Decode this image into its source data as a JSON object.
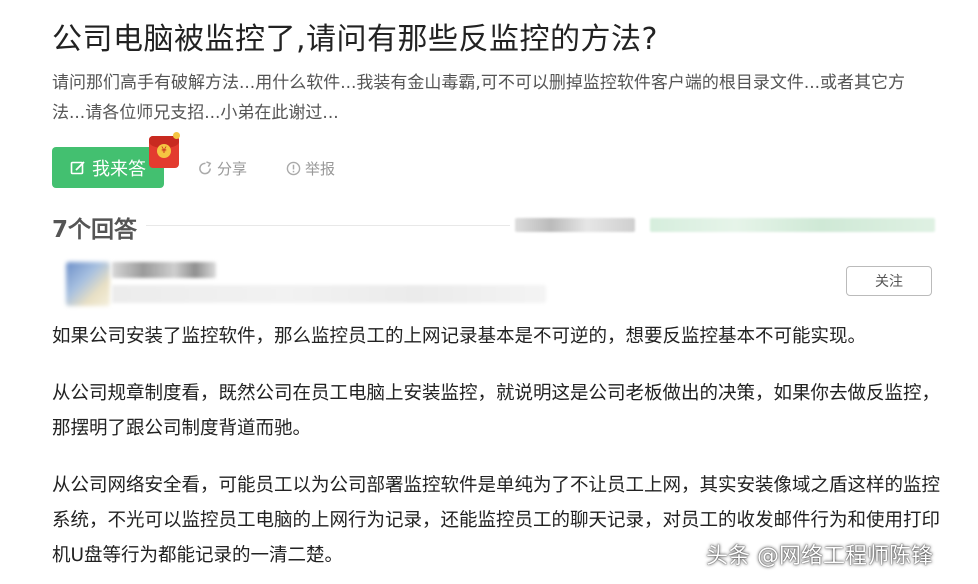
{
  "question": {
    "title": "公司电脑被监控了,请问有那些反监控的方法?",
    "description": "请问那们高手有破解方法...用什么软件...我装有金山毒霸,可不可以删掉监控软件客户端的根目录文件...或者其它方法...请各位师兄支招...小弟在此谢过..."
  },
  "actions": {
    "answer_label": "我来答",
    "share_label": "分享",
    "report_label": "举报"
  },
  "answers": {
    "count_label": "7个回答"
  },
  "answer": {
    "follow_label": "关注",
    "paragraphs": [
      "如果公司安装了监控软件，那么监控员工的上网记录基本是不可逆的，想要反监控基本不可能实现。",
      "从公司规章制度看，既然公司在员工电脑上安装监控，就说明这是公司老板做出的决策，如果你去做反监控，那摆明了跟公司制度背道而驰。",
      "从公司网络安全看，可能员工以为公司部署监控软件是单纯为了不让员工上网，其实安装像域之盾这样的监控系统，不光可以监控员工电脑的上网行为记录，还能监控员工的聊天记录，对员工的收发邮件行为和使用打印机U盘等行为都能记录的一清二楚。"
    ]
  },
  "watermark": "头条 @网络工程师陈锋",
  "colors": {
    "accent_green": "#43c070",
    "red_packet": "#e33b2f"
  }
}
